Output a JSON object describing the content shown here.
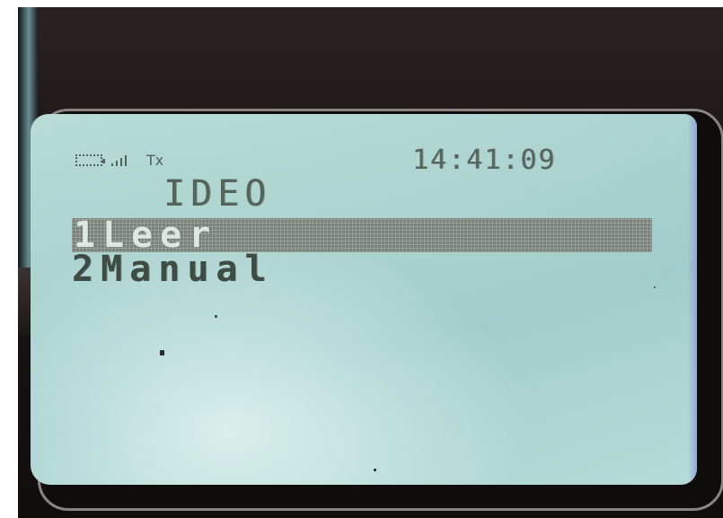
{
  "device_screen": {
    "status_bar": {
      "battery_icon": "battery-icon",
      "signal_icon": "signal-bars-icon",
      "tx_indicator": "Tx",
      "clock": "14:41:09"
    },
    "title": "IDEO",
    "menu": {
      "items": [
        {
          "number": "1",
          "label": "Leer",
          "selected": true
        },
        {
          "number": "2",
          "label": "Manual",
          "selected": false
        }
      ]
    }
  },
  "colors": {
    "lcd_background": "#b1d6d1",
    "lcd_text": "#3e4c43",
    "selection_bar": "#7b817b",
    "device_body": "#1a1414"
  }
}
